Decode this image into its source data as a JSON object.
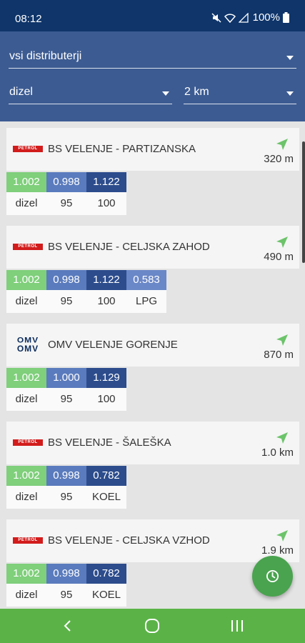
{
  "status_bar": {
    "time": "08:12",
    "battery": "100%"
  },
  "filters": {
    "distributor": "vsi distributerji",
    "fuel": "dizel",
    "radius": "2 km"
  },
  "colors": {
    "dizel": "#7fcf7b",
    "95": "#5a7bbd",
    "100": "#2c4c8c",
    "LPG": "#6a87c7",
    "KOEL": "#2c4c8c",
    "header": "#3c5b92",
    "status": "#0f356a",
    "navbar": "#5bb347",
    "fab": "#4aa34f"
  },
  "stations": [
    {
      "logo": "PETROL",
      "name": "BS VELENJE - PARTIZANSKA",
      "distance": "320 m",
      "prices": [
        {
          "value": "1.002",
          "label": "dizel"
        },
        {
          "value": "0.998",
          "label": "95"
        },
        {
          "value": "1.122",
          "label": "100"
        }
      ]
    },
    {
      "logo": "PETROL",
      "name": "BS VELENJE - CELJSKA ZAHOD",
      "distance": "490 m",
      "prices": [
        {
          "value": "1.002",
          "label": "dizel"
        },
        {
          "value": "0.998",
          "label": "95"
        },
        {
          "value": "1.122",
          "label": "100"
        },
        {
          "value": "0.583",
          "label": "LPG"
        }
      ]
    },
    {
      "logo": "OMV",
      "name": "OMV VELENJE GORENJE",
      "distance": "870 m",
      "prices": [
        {
          "value": "1.002",
          "label": "dizel"
        },
        {
          "value": "1.000",
          "label": "95"
        },
        {
          "value": "1.129",
          "label": "100"
        }
      ]
    },
    {
      "logo": "PETROL",
      "name": "BS VELENJE - ŠALEŠKA",
      "distance": "1.0 km",
      "prices": [
        {
          "value": "1.002",
          "label": "dizel"
        },
        {
          "value": "0.998",
          "label": "95"
        },
        {
          "value": "0.782",
          "label": "KOEL"
        }
      ]
    },
    {
      "logo": "PETROL",
      "name": "BS VELENJE - CELJSKA VZHOD",
      "distance": "1.9 km",
      "prices": [
        {
          "value": "1.002",
          "label": "dizel"
        },
        {
          "value": "0.998",
          "label": "95"
        },
        {
          "value": "0.782",
          "label": "KOEL"
        }
      ]
    }
  ]
}
